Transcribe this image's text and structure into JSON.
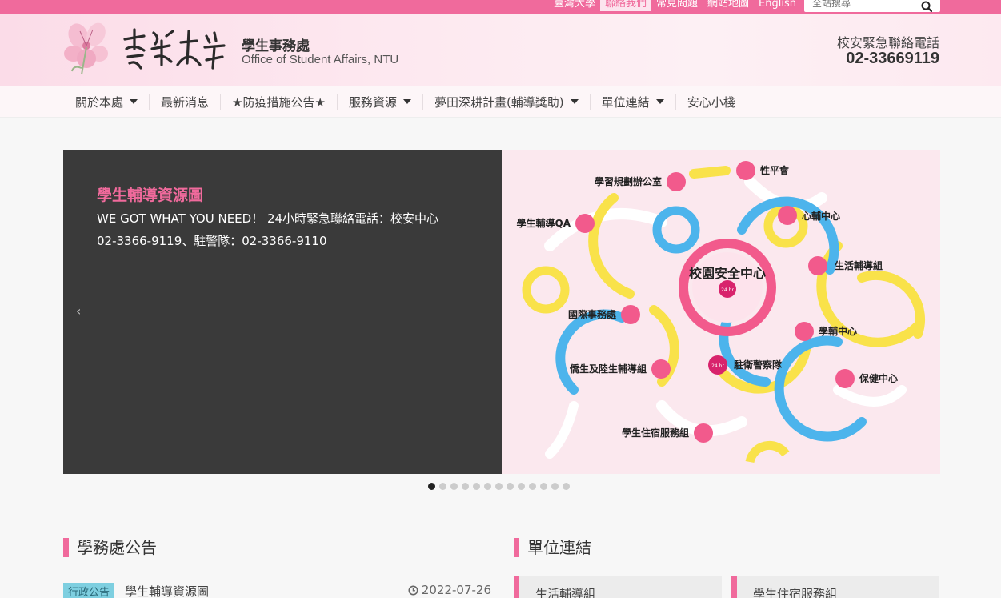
{
  "topbar": {
    "links": [
      "臺灣大學",
      "聯絡我們",
      "常見問題",
      "網站地圖",
      "English"
    ],
    "active_link": "聯絡我們",
    "search_placeholder": "全站搜尋"
  },
  "header": {
    "org_name_zh": "學生事務處",
    "org_name_en": "Office of Student Affairs, NTU",
    "emergency_label": "校安緊急聯絡電話",
    "emergency_phone": "02-33669119"
  },
  "nav": {
    "items": [
      {
        "label": "關於本處",
        "dropdown": true
      },
      {
        "label": "最新消息",
        "dropdown": false
      },
      {
        "label": "★防疫措施公告★",
        "dropdown": false
      },
      {
        "label": "服務資源",
        "dropdown": true
      },
      {
        "label": "夢田深耕計畫(輔導獎助)",
        "dropdown": true
      },
      {
        "label": "單位連結",
        "dropdown": true
      },
      {
        "label": "安心小棧",
        "dropdown": false
      }
    ]
  },
  "slider": {
    "title": "學生輔導資源圖",
    "description": "WE GOT WHAT YOU NEED！ 24小時緊急聯絡電話：校安中心02-3366-9119、駐警隊：02-3366-9110",
    "prev_label": "‹",
    "dot_count": 13,
    "active_dot": 0,
    "graphic": {
      "center_label": "校園安全中心",
      "center_badge": "24 hr",
      "nodes": [
        "學習規劃辦公室",
        "性平會",
        "學生輔導QA",
        "心輔中心",
        "生活輔導組",
        "國際事務處",
        "學輔中心",
        "僑生及陸生輔導組",
        "駐衛警察隊",
        "保健中心",
        "學生住宿服務組"
      ],
      "police_badge": "24 hr"
    }
  },
  "announcements": {
    "title": "學務處公告",
    "items": [
      {
        "tag": "行政公告",
        "title": "學生輔導資源圖",
        "date": "2022-07-26"
      }
    ]
  },
  "units": {
    "title": "單位連結",
    "items": [
      "生活輔導組",
      "學生住宿服務組"
    ]
  },
  "colors": {
    "brand_pink": "#f06a9c",
    "slide_dark": "#3a3a3a",
    "tag_blue": "#7ecfe0"
  }
}
